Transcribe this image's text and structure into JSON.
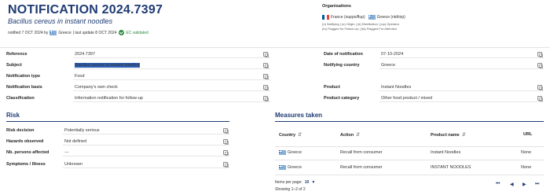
{
  "header": {
    "title": "NOTIFICATION 2024.7397",
    "subtitle": "Bacillus cereus in instant noodles",
    "notified_prefix": "notified 7 OCT 2024 by",
    "notified_country": "Greece",
    "last_update": "| last update 8 OCT 2024",
    "ec_validated": "EC validated"
  },
  "organisations": {
    "title": "Organisations",
    "orgs": [
      {
        "flag": "fr-flag-icon",
        "text": "France (ouppo/flup)"
      },
      {
        "flag": "gr-flag-icon",
        "text": "Greece (ntd/oip)"
      }
    ],
    "legend_line1": "(n) Notifying | (o) Origin | (d) Distribution | (op) Operator",
    "legend_line2": "(fu) Flagged for Follow-Up | (fa) Flagged For Attention"
  },
  "details_left": [
    {
      "label": "Reference",
      "value": "2024.7397"
    },
    {
      "label": "Subject",
      "value": "Bacillus cereus in instant noodles",
      "highlighted": true
    },
    {
      "label": "Notification type",
      "value": "Food"
    },
    {
      "label": "Notification basis",
      "value": "Company's own check"
    },
    {
      "label": "Classification",
      "value": "Information notification for follow-up"
    }
  ],
  "details_right": [
    {
      "label": "Date of notification",
      "value": "07-10-2024"
    },
    {
      "label": "Notifying country",
      "value": "Greece"
    },
    {
      "label": "Product",
      "value": "Instant Noodles"
    },
    {
      "label": "Product category",
      "value": "Other food product / mixed"
    }
  ],
  "risk": {
    "title": "Risk",
    "rows": [
      {
        "label": "Risk decision",
        "value": "Potentially serious"
      },
      {
        "label": "Hazards observed",
        "value": "Not defined"
      },
      {
        "label": "Nb. persons affected",
        "value": "---"
      },
      {
        "label": "Symptoms / Illness",
        "value": "Unknown"
      }
    ]
  },
  "measures": {
    "title": "Measures taken",
    "columns": [
      "Country",
      "Action",
      "Product name",
      "URL"
    ],
    "rows": [
      {
        "country": "Greece",
        "action": "Recall from consumer",
        "product": "Instant Noodles",
        "url": "None"
      },
      {
        "country": "Greece",
        "action": "Recall from consumer",
        "product": "INSTANT NOODLES",
        "url": "None"
      }
    ],
    "items_per_page_label": "Items per page:",
    "items_per_page_value": "10",
    "showing": "Showing 1–2 of 2"
  },
  "colors": {
    "accent": "#1f3b73",
    "highlight": "#2f5fb3",
    "validated": "#2e8b3e"
  }
}
